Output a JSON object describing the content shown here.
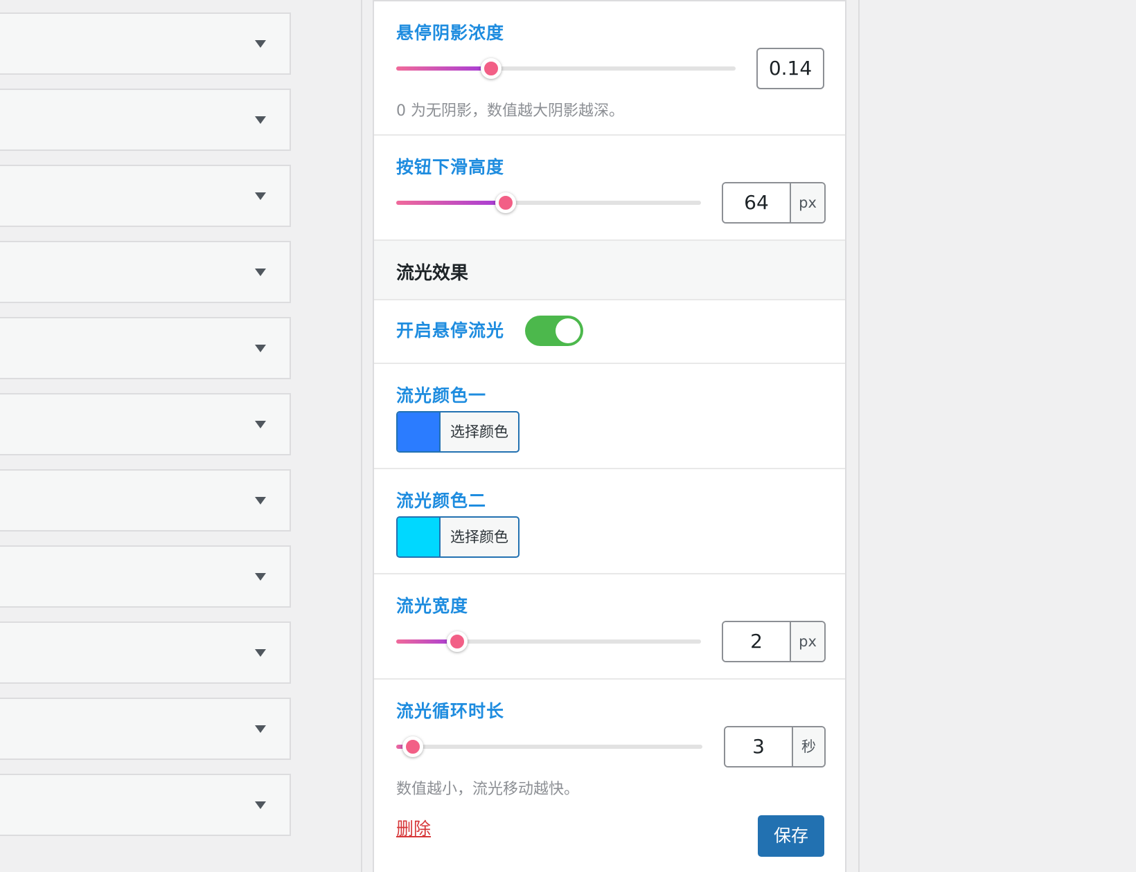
{
  "left_widgets": {
    "count": 11
  },
  "shadow_depth": {
    "label": "悬停阴影浓度",
    "value": "0.14",
    "slider_fraction": 0.28,
    "description": "0 为无阴影，数值越大阴影越深。"
  },
  "slide_height": {
    "label": "按钮下滑高度",
    "value": "64",
    "unit": "px",
    "slider_fraction": 0.36
  },
  "shine_group": {
    "title": "流光效果"
  },
  "hover_shine": {
    "label": "开启悬停流光",
    "enabled": true
  },
  "color_one": {
    "label": "流光颜色一",
    "button_text": "选择颜色",
    "color": "#2b7cff"
  },
  "color_two": {
    "label": "流光颜色二",
    "button_text": "选择颜色",
    "color": "#00d8ff"
  },
  "shine_width": {
    "label": "流光宽度",
    "value": "2",
    "unit": "px",
    "slider_fraction": 0.2
  },
  "shine_duration": {
    "label": "流光循环时长",
    "value": "3",
    "unit": "秒",
    "slider_fraction": 0.055,
    "description": "数值越小，流光移动越快。"
  },
  "actions": {
    "delete_label": "删除",
    "save_label": "保存"
  },
  "colors": {
    "accent": "#2271b1",
    "label_blue": "#1e8cdf",
    "toggle_green": "#4cb84c",
    "thumb_pink": "#f25f86",
    "danger": "#d63638"
  }
}
